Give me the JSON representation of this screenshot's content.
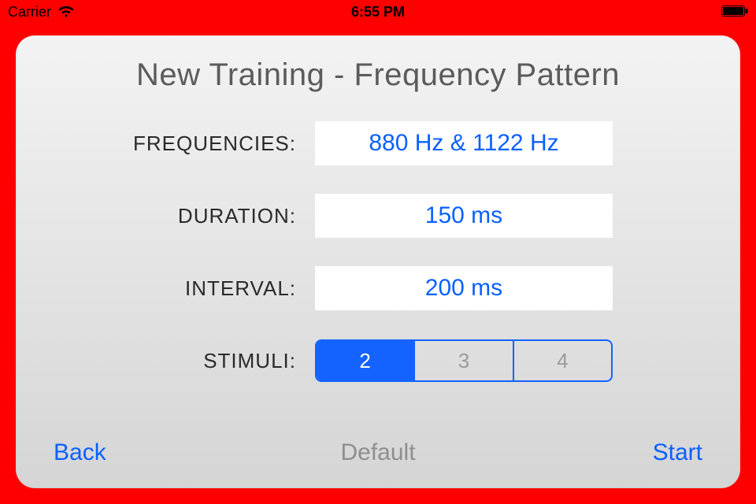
{
  "status": {
    "carrier": "Carrier",
    "time": "6:55 PM"
  },
  "title": "New Training - Frequency Pattern",
  "form": {
    "frequencies": {
      "label": "FREQUENCIES:",
      "value": "880 Hz & 1122 Hz"
    },
    "duration": {
      "label": "DURATION:",
      "value": "150 ms"
    },
    "interval": {
      "label": "INTERVAL:",
      "value": "200 ms"
    },
    "stimuli": {
      "label": "STIMULI:",
      "options": [
        "2",
        "3",
        "4"
      ],
      "selected": "2"
    }
  },
  "toolbar": {
    "back": "Back",
    "default": "Default",
    "start": "Start"
  }
}
